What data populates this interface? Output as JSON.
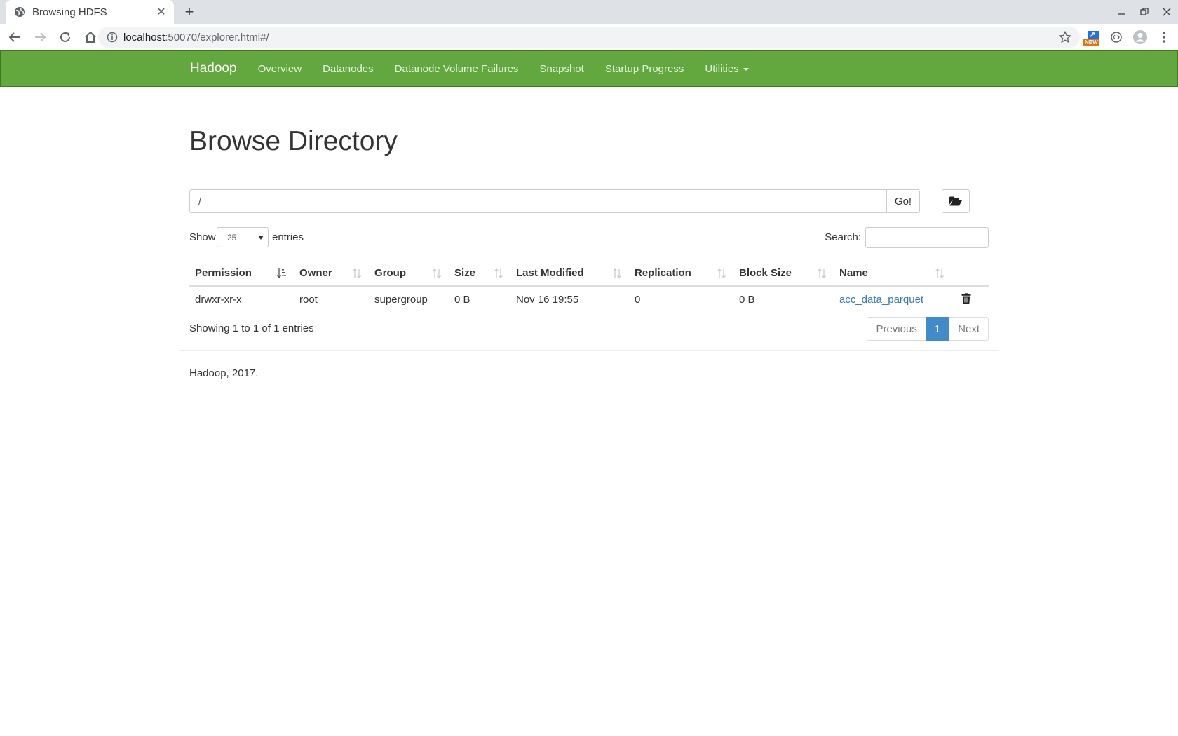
{
  "browser": {
    "tab_title": "Browsing HDFS",
    "url_host": "localhost",
    "url_path": ":50070/explorer.html#/",
    "new_badge": "NEW"
  },
  "navbar": {
    "brand": "Hadoop",
    "links": [
      "Overview",
      "Datanodes",
      "Datanode Volume Failures",
      "Snapshot",
      "Startup Progress",
      "Utilities"
    ]
  },
  "page": {
    "title": "Browse Directory",
    "path_value": "/",
    "go_label": "Go!",
    "show_label": "Show",
    "entries_select": "25",
    "entries_label": "entries",
    "search_label": "Search:",
    "search_value": ""
  },
  "table": {
    "columns": [
      "Permission",
      "Owner",
      "Group",
      "Size",
      "Last Modified",
      "Replication",
      "Block Size",
      "Name"
    ],
    "rows": [
      {
        "permission": "drwxr-xr-x",
        "owner": "root",
        "group": "supergroup",
        "size": "0 B",
        "last_modified": "Nov 16 19:55",
        "replication": "0",
        "block_size": "0 B",
        "name": "acc_data_parquet"
      }
    ]
  },
  "footer_info": {
    "showing": "Showing 1 to 1 of 1 entries",
    "prev": "Previous",
    "page": "1",
    "next": "Next",
    "copyright": "Hadoop, 2017."
  },
  "colors": {
    "navbar": "#62a83e",
    "link": "#337ab7",
    "active_page": "#428bca"
  }
}
